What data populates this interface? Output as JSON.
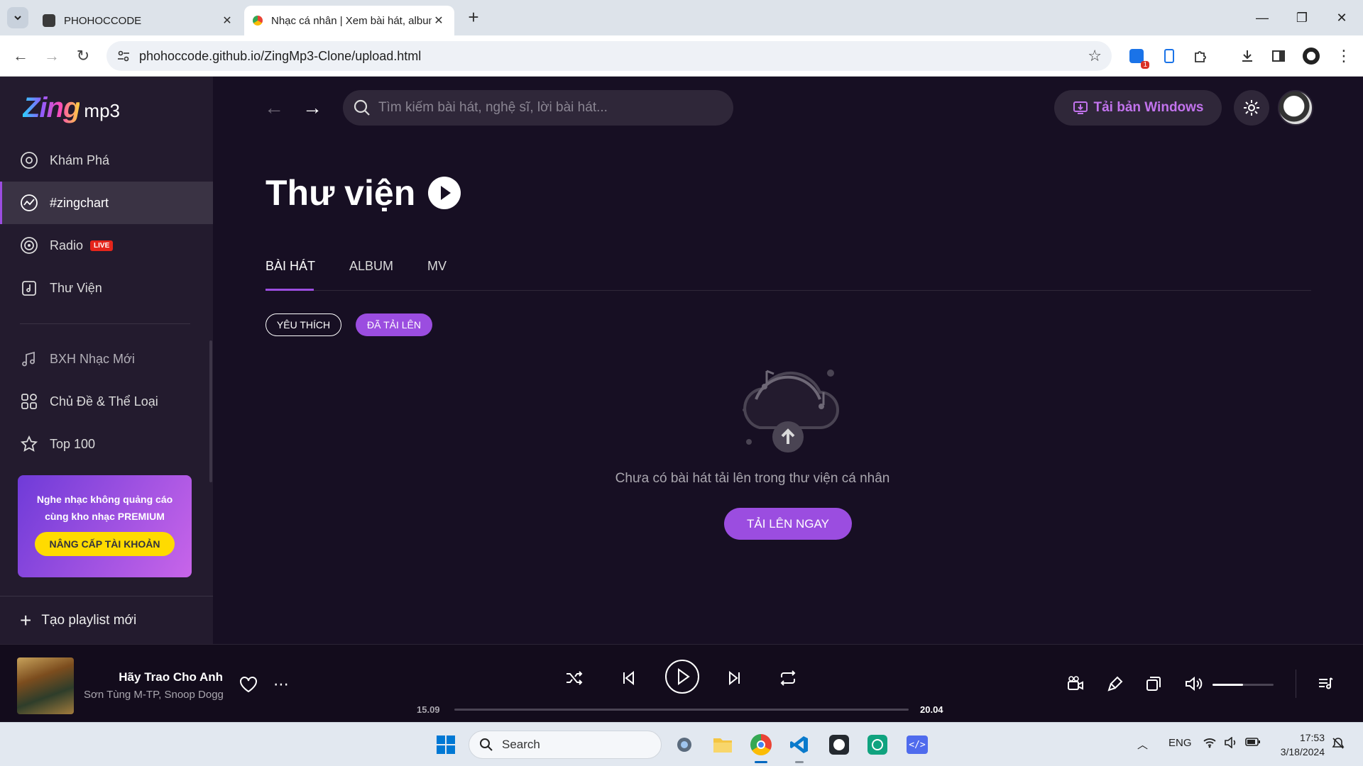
{
  "browser": {
    "tabs": [
      {
        "title": "PHOHOCCODE",
        "active": false
      },
      {
        "title": "Nhạc cá nhân | Xem bài hát, album",
        "active": true
      }
    ],
    "url": "phohoccode.github.io/ZingMp3-Clone/upload.html",
    "extension_badge": "1"
  },
  "brand": {
    "zing": "Zing",
    "mp3": "mp3"
  },
  "sidebar": {
    "items": [
      {
        "label": "Khám Phá",
        "icon": "disc-icon",
        "active": false
      },
      {
        "label": "#zingchart",
        "icon": "chart-icon",
        "active": true
      },
      {
        "label": "Radio",
        "icon": "radio-icon",
        "active": false,
        "badge": "LIVE"
      },
      {
        "label": "Thư Viện",
        "icon": "library-icon",
        "active": false
      }
    ],
    "items2": [
      {
        "label": "BXH Nhạc Mới",
        "icon": "music-note-icon"
      },
      {
        "label": "Chủ Đề & Thể Loại",
        "icon": "category-icon"
      },
      {
        "label": "Top 100",
        "icon": "star-icon"
      }
    ],
    "premium": {
      "message": "Nghe nhạc không quảng cáo cùng kho nhạc PREMIUM",
      "button": "NÂNG CẤP TÀI KHOẢN"
    },
    "new_playlist": "Tạo playlist mới"
  },
  "header": {
    "search_placeholder": "Tìm kiếm bài hát, nghệ sĩ, lời bài hát...",
    "download_button": "Tải bản Windows"
  },
  "library": {
    "title": "Thư viện",
    "tabs": [
      "BÀI HÁT",
      "ALBUM",
      "MV"
    ],
    "active_tab": "BÀI HÁT",
    "chips": [
      "YÊU THÍCH",
      "ĐÃ TẢI LÊN"
    ],
    "active_chip": "ĐÃ TẢI LÊN",
    "empty_message": "Chưa có bài hát tải lên trong thư viện cá nhân",
    "upload_button": "TẢI LÊN NGAY"
  },
  "player": {
    "title": "Hãy Trao Cho Anh",
    "artist": "Sơn Tùng M-TP, Snoop Dogg",
    "current_time": "15.09",
    "duration": "20.04",
    "progress": 0,
    "volume": 0.5
  },
  "taskbar": {
    "search_label": "Search",
    "language": "ENG",
    "time": "17:53",
    "date": "3/18/2024"
  },
  "colors": {
    "accent": "#9b4de0",
    "sidebar_bg": "#231b2e",
    "main_bg": "#170f23",
    "premium_button": "#ffdb00"
  }
}
